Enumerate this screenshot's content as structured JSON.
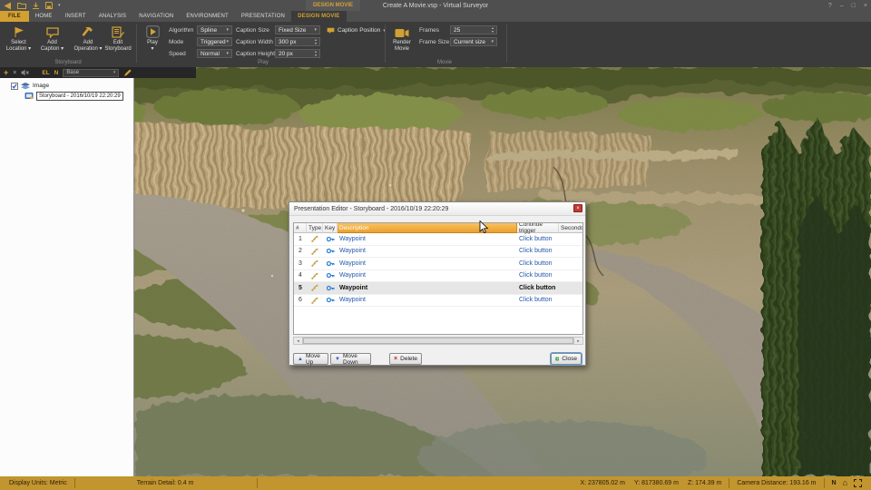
{
  "titlebar": {
    "title": "Create A Movie.vsp  -  Virtual Surveyor",
    "contextual_header": "DESIGN MOVIE"
  },
  "window_controls": {
    "help": "?",
    "minimize": "–",
    "maximize": "□",
    "close": "×"
  },
  "tabs": [
    {
      "label": "FILE"
    },
    {
      "label": "HOME"
    },
    {
      "label": "INSERT"
    },
    {
      "label": "ANALYSIS"
    },
    {
      "label": "NAVIGATION"
    },
    {
      "label": "ENVIRONMENT"
    },
    {
      "label": "PRESENTATION"
    },
    {
      "label": "DESIGN MOVIE"
    }
  ],
  "ribbon": {
    "storyboard": {
      "group_label": "Storyboard",
      "select_location": {
        "l1": "Select",
        "l2": "Location ▾"
      },
      "add_caption": {
        "l1": "Add",
        "l2": "Caption ▾"
      },
      "add_operation": {
        "l1": "Add",
        "l2": "Operation ▾"
      },
      "edit_storyboard": {
        "l1": "Edit",
        "l2": "Storyboard"
      }
    },
    "play": {
      "group_label": "Play",
      "play_button": "Play",
      "algorithm": {
        "label": "Algorithm",
        "value": "Spline"
      },
      "mode": {
        "label": "Mode",
        "value": "Triggered"
      },
      "speed": {
        "label": "Speed",
        "value": "Normal"
      },
      "caption_size": {
        "label": "Caption Size",
        "value": "Fixed Size"
      },
      "caption_width": {
        "label": "Caption Width",
        "value": "300 px"
      },
      "caption_height": {
        "label": "Caption Height",
        "value": "20 px"
      },
      "caption_position": "Caption Position"
    },
    "movie": {
      "group_label": "Movie",
      "render": {
        "l1": "Render",
        "l2": "Movie"
      },
      "frames": {
        "label": "Frames",
        "value": "25"
      },
      "frame_size": {
        "label": "Frame Size",
        "value": "Current size"
      }
    }
  },
  "project_panel": {
    "toolbar": {
      "el": "EL",
      "n": "N",
      "layer_value": "Base"
    },
    "tree": {
      "root": "Image",
      "storyboard": "Storyboard - 2016/10/19 22:20:29"
    }
  },
  "dialog": {
    "title": "Presentation Editor - Storyboard - 2016/10/19 22:20:29",
    "columns": {
      "num": "#",
      "type": "Type",
      "key": "Key",
      "description": "Description",
      "trigger": "Continue trigger",
      "seconds": "Seconds"
    },
    "rows": [
      {
        "num": "1",
        "description": "Waypoint",
        "trigger": "Click button",
        "seconds": ""
      },
      {
        "num": "2",
        "description": "Waypoint",
        "trigger": "Click button",
        "seconds": ""
      },
      {
        "num": "3",
        "description": "Waypoint",
        "trigger": "Click button",
        "seconds": ""
      },
      {
        "num": "4",
        "description": "Waypoint",
        "trigger": "Click button",
        "seconds": ""
      },
      {
        "num": "5",
        "description": "Waypoint",
        "trigger": "Click button",
        "seconds": ""
      },
      {
        "num": "6",
        "description": "Waypoint",
        "trigger": "Click button",
        "seconds": ""
      }
    ],
    "selected_row": 5,
    "buttons": {
      "move_up": "Move Up",
      "move_down": "Move Down",
      "delete": "Delete",
      "close": "Close"
    }
  },
  "statusbar": {
    "display_units": "Display Units:  Metric",
    "terrain_detail": "Terrain Detail: 0.4 m",
    "x": "X: 237805.02 m",
    "y": "Y: 817380.69 m",
    "z": "Z: 174.39 m",
    "camera": "Camera Distance: 193.16 m",
    "north": "N"
  },
  "glyphs": {
    "caret": "▾",
    "spin_up": "▴",
    "spin_down": "▾",
    "plus": "+",
    "close_small": "×",
    "scroll_left": "◄",
    "scroll_right": "►",
    "up_arrow": "▲",
    "down_arrow": "▼",
    "delete_x": "×",
    "home": "⌂"
  },
  "icons": {
    "select_location": "flag",
    "add_caption": "speech-bubble",
    "add_operation": "hammer",
    "edit_storyboard": "document-pencil",
    "play": "play-triangle",
    "caption_position": "speech-bubble",
    "render_movie": "video-camera",
    "tree_root": "layers",
    "tree_child": "storyboard-slide",
    "row_type": "waypoint-path",
    "row_key": "key",
    "close_button": "green-window"
  },
  "colors": {
    "accent": "#D2A033",
    "statusbar": "#C2952F",
    "link": "#2357AE",
    "header_highlight": "#F1B24C",
    "selection": "#E6E6E6",
    "dialog_close": "#C13B33"
  }
}
